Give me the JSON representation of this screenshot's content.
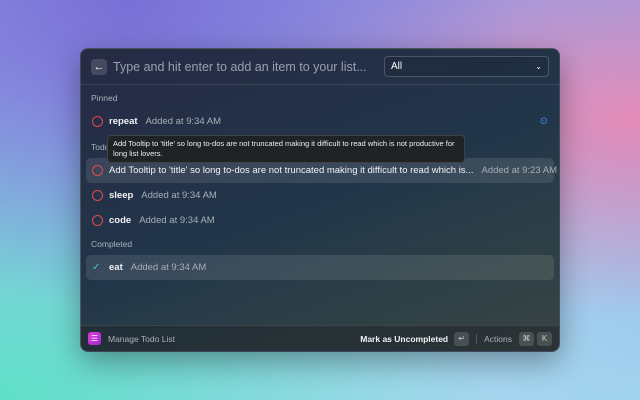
{
  "search": {
    "placeholder": "Type and hit enter to add an item to your list...",
    "filter": "All"
  },
  "sections": {
    "pinned": "Pinned",
    "todo": "Todo",
    "completed": "Completed"
  },
  "pinned": [
    {
      "title": "repeat",
      "meta": "Added at 9:34 AM",
      "icon": "pin-icon",
      "accent": "#3b8eea"
    }
  ],
  "todo": [
    {
      "title": "Add Tooltip to 'title' so long to-dos are not truncated making it difficult to read which is...",
      "meta": "Added at 9:23 AM"
    },
    {
      "title": "sleep",
      "meta": "Added at 9:34 AM"
    },
    {
      "title": "code",
      "meta": "Added at 9:34 AM"
    }
  ],
  "completed": [
    {
      "title": "eat",
      "meta": "Added at 9:34 AM"
    }
  ],
  "tooltip": "Add Tooltip to 'title' so long to-dos are not truncated making it difficult to read which is not productive for long list lovers.",
  "footer": {
    "app": "Manage Todo List",
    "primary_action": "Mark as Uncompleted",
    "enter_key": "↵",
    "actions": "Actions",
    "cmd_key": "⌘",
    "k_key": "K"
  },
  "colors": {
    "incomplete": "#e5484d",
    "complete": "#4cc9c0",
    "app_icon": "#d43ad4"
  }
}
